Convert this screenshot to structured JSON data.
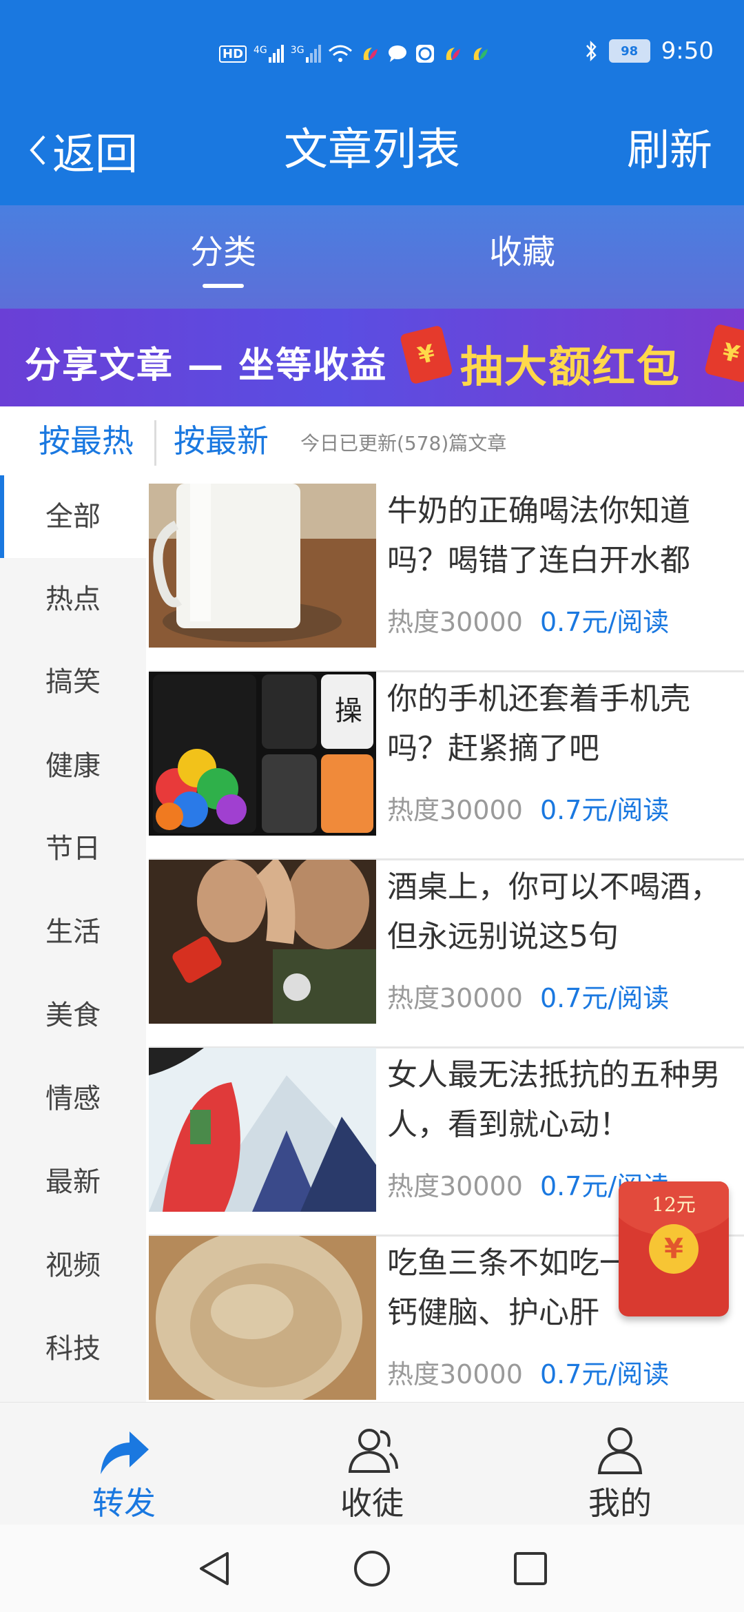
{
  "status_bar": {
    "network_left": "HD",
    "signal_1": "4G",
    "signal_2": "3G",
    "battery": "98",
    "time": "9:50"
  },
  "navbar": {
    "back_label": "返回",
    "title": "文章列表",
    "refresh_label": "刷新"
  },
  "tabs": [
    {
      "label": "分类",
      "active": true
    },
    {
      "label": "收藏",
      "active": false
    }
  ],
  "banner": {
    "left_text": "分享文章 — 坐等收益",
    "right_text": "抽大额红包",
    "coin_symbol": "¥"
  },
  "sort": {
    "hot_label": "按最热",
    "new_label": "按最新",
    "update_info": "今日已更新(578)篇文章"
  },
  "categories": [
    "全部",
    "热点",
    "搞笑",
    "健康",
    "节日",
    "生活",
    "美食",
    "情感",
    "最新",
    "视频",
    "科技"
  ],
  "articles": [
    {
      "title": "牛奶的正确喝法你知道吗？喝错了连白开水都",
      "heat": "热度30000",
      "price": "0.7元/阅读"
    },
    {
      "title": "你的手机还套着手机壳吗？赶紧摘了吧",
      "heat": "热度30000",
      "price": "0.7元/阅读"
    },
    {
      "title": "酒桌上，你可以不喝酒，但永远别说这5句",
      "heat": "热度30000",
      "price": "0.7元/阅读"
    },
    {
      "title": "女人最无法抵抗的五种男人，看到就心动！",
      "heat": "热度30000",
      "price": "0.7元/阅读"
    },
    {
      "title": "吃鱼三条不如吃一勺！补钙健脑、护心肝",
      "heat": "热度30000",
      "price": "0.7元/阅读"
    }
  ],
  "float_red_packet": {
    "amount": "12元",
    "symbol": "¥"
  },
  "bottom_nav": [
    {
      "label": "转发",
      "icon": "share-arrow-icon",
      "active": true
    },
    {
      "label": "收徒",
      "icon": "users-icon",
      "active": false
    },
    {
      "label": "我的",
      "icon": "user-icon",
      "active": false
    }
  ],
  "colors": {
    "primary": "#1a78e0",
    "banner_accent": "#ffd84a",
    "red_packet": "#d93a30"
  }
}
